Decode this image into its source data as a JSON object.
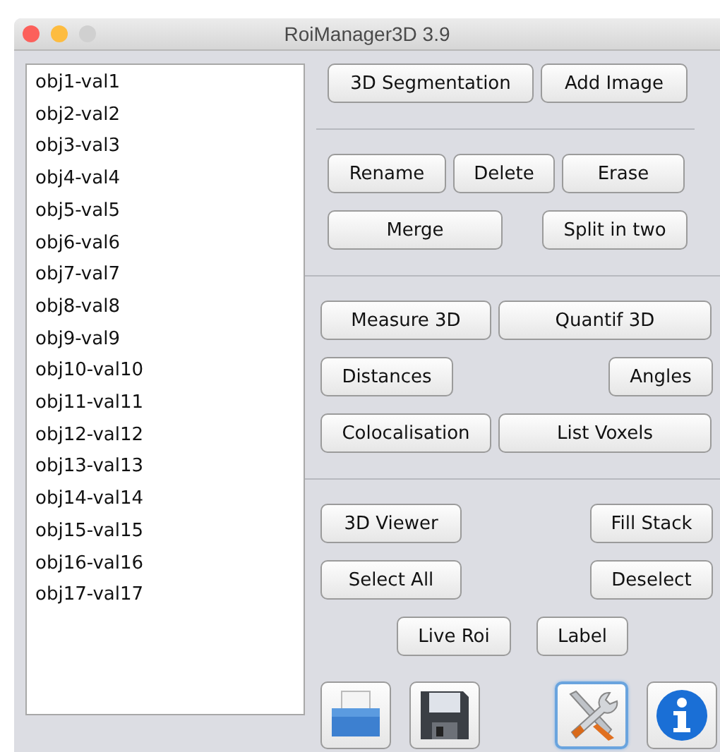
{
  "window": {
    "title": "RoiManager3D 3.9",
    "controls": [
      {
        "color": "#fc605b"
      },
      {
        "color": "#fdbc40"
      },
      {
        "color": "#d0d0d0"
      }
    ]
  },
  "list": {
    "items": [
      "obj1-val1",
      "obj2-val2",
      "obj3-val3",
      "obj4-val4",
      "obj5-val5",
      "obj6-val6",
      "obj7-val7",
      "obj8-val8",
      "obj9-val9",
      "obj10-val10",
      "obj11-val11",
      "obj12-val12",
      "obj13-val13",
      "obj14-val14",
      "obj15-val15",
      "obj16-val16",
      "obj17-val17"
    ]
  },
  "sections": [
    {
      "buttons": [
        "3D Segmentation",
        "Add Image"
      ]
    },
    {
      "buttons": [
        "Rename",
        "Delete",
        "Erase",
        "Merge",
        "Split in two"
      ]
    },
    {
      "buttons": [
        "Measure 3D",
        "Quantif 3D",
        "Distances",
        "Angles",
        "Colocalisation",
        "List Voxels"
      ]
    },
    {
      "buttons": [
        "3D Viewer",
        "Fill Stack",
        "Select All",
        "Deselect",
        "Live Roi",
        "Label"
      ]
    }
  ],
  "icon_buttons": [
    {
      "kind": "print",
      "focused": false
    },
    {
      "kind": "save",
      "focused": false
    },
    {
      "kind": "tools",
      "focused": true
    },
    {
      "kind": "info",
      "focused": false
    }
  ]
}
